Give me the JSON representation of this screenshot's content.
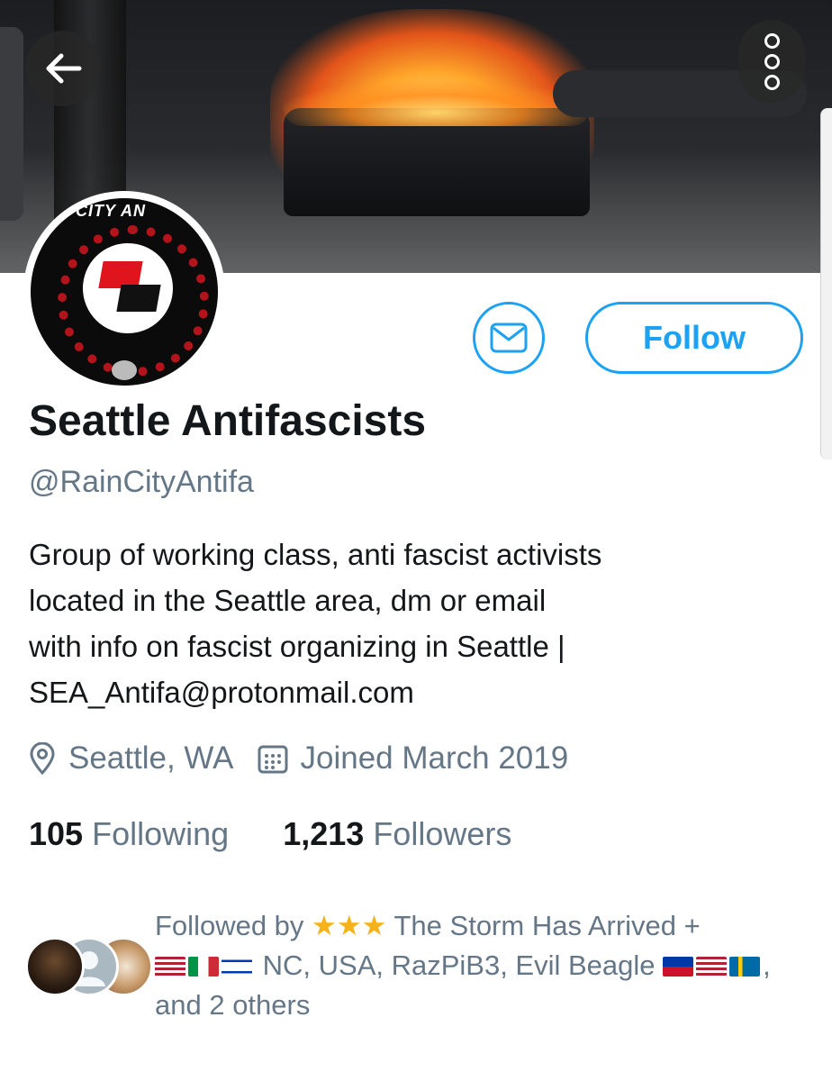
{
  "header": {
    "back_icon": "arrow-left-icon",
    "more_icon": "more-vertical-icon"
  },
  "profile": {
    "display_name": "Seattle Antifascists",
    "handle": "@RainCityAntifa",
    "avatar_text": "CITY AN",
    "follow_label": "Follow",
    "message_icon": "envelope-icon",
    "bio_lines": [
      "Group of working class, anti fascist activists",
      "located in the Seattle area, dm or email",
      "with info on fascist organizing in Seattle |",
      "SEA_Antifa@protonmail.com"
    ],
    "location": "Seattle, WA",
    "joined": "Joined March 2019",
    "following_count": "105",
    "following_label": "Following",
    "followers_count": "1,213",
    "followers_label": "Followers"
  },
  "followed_by": {
    "prefix": "Followed by",
    "line1_name": "The Storm Has Arrived",
    "line1_suffix": "+",
    "line2_text": "NC, USA, RazPiB3, Evil Beagle",
    "line3_text": "and 2 others",
    "star_glyph": "★"
  },
  "colors": {
    "accent": "#1da1f2",
    "text_primary": "#14171a",
    "text_secondary": "#657786"
  }
}
